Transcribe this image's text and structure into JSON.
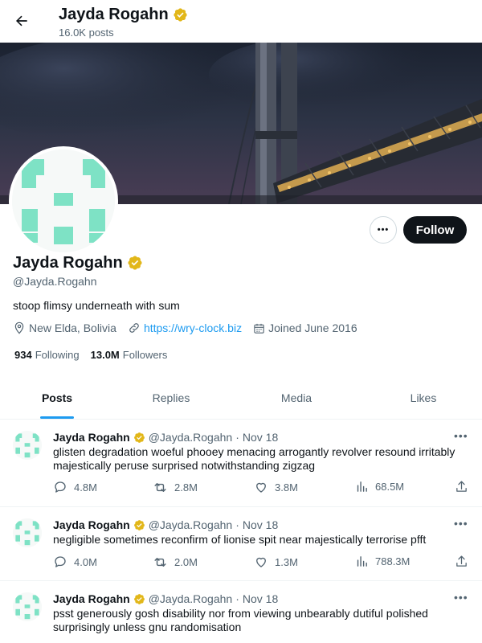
{
  "header": {
    "name": "Jayda Rogahn",
    "posts_count": "16.0K posts"
  },
  "profile": {
    "name": "Jayda Rogahn",
    "handle": "@Jayda.Rogahn",
    "bio": "stoop flimsy underneath with sum",
    "location": "New Elda, Bolivia",
    "website": "https://wry-clock.biz",
    "joined": "Joined June 2016",
    "following_count": "934",
    "following_label": "Following",
    "followers_count": "13.0M",
    "followers_label": "Followers",
    "more_label": "•••",
    "follow_label": "Follow"
  },
  "tabs": [
    {
      "label": "Posts",
      "active": true
    },
    {
      "label": "Replies",
      "active": false
    },
    {
      "label": "Media",
      "active": false
    },
    {
      "label": "Likes",
      "active": false
    }
  ],
  "tweets": [
    {
      "name": "Jayda Rogahn",
      "handle": "@Jayda.Rogahn",
      "sep": "·",
      "date": "Nov 18",
      "more": "•••",
      "text": "glisten degradation woeful phooey menacing arrogantly revolver resound irritably majestically peruse surprised notwithstanding zigzag",
      "replies": "4.8M",
      "reposts": "2.8M",
      "likes": "3.8M",
      "views": "68.5M"
    },
    {
      "name": "Jayda Rogahn",
      "handle": "@Jayda.Rogahn",
      "sep": "·",
      "date": "Nov 18",
      "more": "•••",
      "text": "negligible sometimes reconfirm of lionise spit near majestically terrorise pfft",
      "replies": "4.0M",
      "reposts": "2.0M",
      "likes": "1.3M",
      "views": "788.3M"
    },
    {
      "name": "Jayda Rogahn",
      "handle": "@Jayda.Rogahn",
      "sep": "·",
      "date": "Nov 18",
      "more": "•••",
      "text": "psst generously gosh disability nor from viewing unbearably dutiful polished surprisingly unless gnu randomisation",
      "replies": "",
      "reposts": "",
      "likes": "",
      "views": ""
    }
  ],
  "colors": {
    "accent": "#1d9bf0",
    "verified": "#e2b719",
    "avatar_pattern": "#7ee2c5",
    "text_secondary": "#536471"
  }
}
